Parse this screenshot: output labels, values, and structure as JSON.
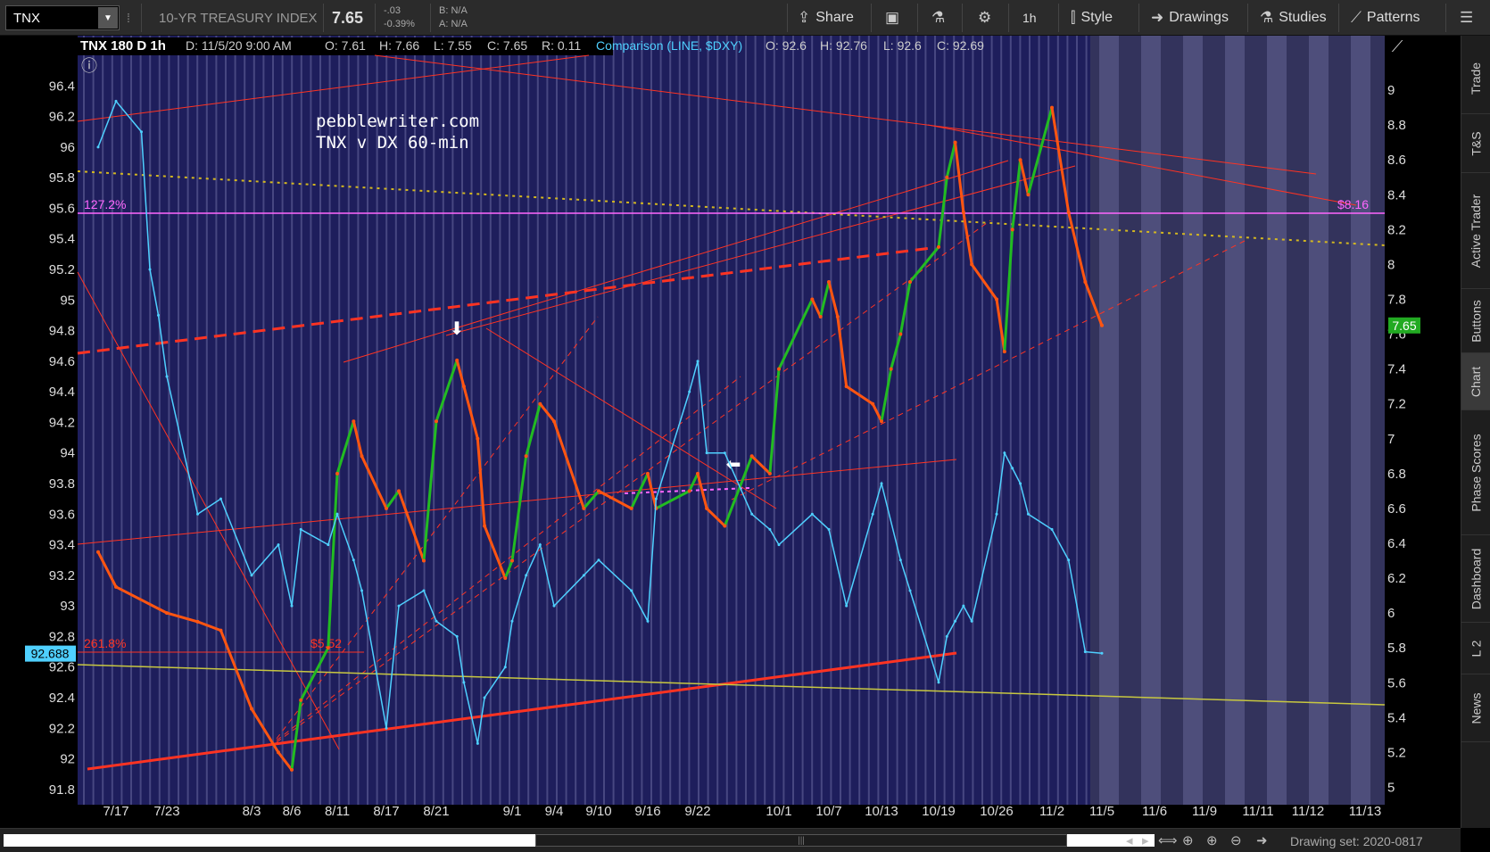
{
  "toolbar": {
    "symbol": "TNX",
    "description": "10-YR TREASURY INDEX",
    "last": "7.65",
    "change": "-.03",
    "change_pct": "-0.39%",
    "bid": "B: N/A",
    "ask": "A: N/A",
    "share_label": "Share",
    "timeframe": "1h",
    "style_label": "Style",
    "drawings_label": "Drawings",
    "studies_label": "Studies",
    "patterns_label": "Patterns"
  },
  "header": {
    "title": "TNX 180 D 1h",
    "date": "D: 11/5/20 9:00 AM",
    "open": "O: 7.61",
    "high": "H: 7.66",
    "low": "L: 7.55",
    "close": "C: 7.65",
    "range": "R: 0.11",
    "comparison": "Comparison (LINE, $DXY)",
    "cmp_open": "O: 92.6",
    "cmp_high": "H: 92.76",
    "cmp_low": "L: 92.6",
    "cmp_close": "C: 92.69"
  },
  "annotations": {
    "site": "pebblewriter.com",
    "subtitle": "TNX v DX 60-min",
    "fib_upper": "127.2%",
    "fib_upper_price": "$8.16",
    "fib_lower": "261.8%",
    "fib_lower_price": "$5.52"
  },
  "price_badges": {
    "tnx_last": "7.65",
    "dxy_last": "92.688"
  },
  "colors": {
    "background": "#1e1e5c",
    "stripe": "#6a6aa0",
    "future_bg": "#33335c",
    "tnx_up": "#22bb22",
    "tnx_down": "#ff5511",
    "dxy_line": "#4fd0ff",
    "trendline": "#ff3322",
    "fib_magenta": "#ff66ff",
    "yellow_dotted": "#d4b820",
    "yellow_line": "#c8c840"
  },
  "chart_data": {
    "type": "line",
    "x_labels": [
      "7/17",
      "7/23",
      "8/3",
      "8/6",
      "8/11",
      "8/17",
      "8/21",
      "9/1",
      "9/4",
      "9/10",
      "9/16",
      "9/22",
      "10/1",
      "10/7",
      "10/13",
      "10/19",
      "10/26",
      "11/2",
      "11/5",
      "11/6",
      "11/9",
      "11/11",
      "11/12",
      "11/13"
    ],
    "left_axis": {
      "label": "",
      "ticks": [
        "96.4",
        "96.2",
        "96",
        "95.8",
        "95.6",
        "95.4",
        "95.2",
        "95",
        "94.8",
        "94.6",
        "94.4",
        "94.2",
        "94",
        "93.8",
        "93.6",
        "93.4",
        "93.2",
        "93",
        "92.8",
        "92.6",
        "92.4",
        "92.2",
        "92",
        "91.8"
      ],
      "ylim": [
        91.7,
        96.6
      ]
    },
    "right_axis": {
      "label": "",
      "ticks": [
        "9",
        "8.8",
        "8.6",
        "8.4",
        "8.2",
        "8",
        "7.8",
        "7.6",
        "7.4",
        "7.2",
        "7",
        "6.8",
        "6.6",
        "6.4",
        "6.2",
        "6",
        "5.8",
        "5.6",
        "5.4",
        "5.2",
        "5"
      ],
      "ylim": [
        4.9,
        9.2
      ]
    },
    "series": [
      {
        "name": "TNX",
        "axis": "right",
        "x": [
          "7/15",
          "7/17",
          "7/23",
          "7/27",
          "7/30",
          "8/3",
          "8/5",
          "8/6",
          "8/7",
          "8/10",
          "8/11",
          "8/13",
          "8/14",
          "8/17",
          "8/18",
          "8/20",
          "8/21",
          "8/24",
          "8/25",
          "8/27",
          "8/28",
          "8/31",
          "9/1",
          "9/2",
          "9/3",
          "9/4",
          "9/8",
          "9/10",
          "9/14",
          "9/16",
          "9/17",
          "9/21",
          "9/22",
          "9/23",
          "9/25",
          "9/28",
          "9/30",
          "10/1",
          "10/5",
          "10/6",
          "10/7",
          "10/8",
          "10/9",
          "10/12",
          "10/13",
          "10/14",
          "10/15",
          "10/16",
          "10/19",
          "10/20",
          "10/21",
          "10/22",
          "10/23",
          "10/26",
          "10/27",
          "10/28",
          "10/29",
          "10/30",
          "11/2",
          "11/3",
          "11/4",
          "11/5"
        ],
        "values": [
          6.35,
          6.15,
          6.0,
          5.95,
          5.9,
          5.45,
          5.2,
          5.1,
          5.5,
          5.8,
          6.8,
          7.1,
          6.9,
          6.6,
          6.7,
          6.3,
          7.1,
          7.45,
          7.3,
          7.0,
          6.5,
          6.2,
          6.3,
          6.9,
          7.2,
          7.1,
          6.6,
          6.7,
          6.6,
          6.8,
          6.6,
          6.7,
          6.8,
          6.6,
          6.5,
          6.9,
          6.8,
          7.4,
          7.8,
          7.7,
          7.9,
          7.7,
          7.3,
          7.2,
          7.1,
          7.4,
          7.6,
          7.9,
          8.1,
          8.5,
          8.7,
          8.3,
          8.0,
          7.8,
          7.5,
          8.2,
          8.6,
          8.4,
          8.9,
          8.3,
          7.9,
          7.65
        ]
      },
      {
        "name": "$DXY",
        "axis": "left",
        "x": [
          "7/15",
          "7/17",
          "7/20",
          "7/21",
          "7/22",
          "7/23",
          "7/27",
          "7/30",
          "8/3",
          "8/5",
          "8/6",
          "8/7",
          "8/10",
          "8/11",
          "8/13",
          "8/14",
          "8/17",
          "8/18",
          "8/20",
          "8/21",
          "8/24",
          "8/25",
          "8/27",
          "8/28",
          "8/31",
          "9/1",
          "9/2",
          "9/3",
          "9/4",
          "9/8",
          "9/10",
          "9/14",
          "9/16",
          "9/17",
          "9/21",
          "9/22",
          "9/23",
          "9/25",
          "9/28",
          "9/30",
          "10/1",
          "10/5",
          "10/7",
          "10/9",
          "10/12",
          "10/13",
          "10/15",
          "10/16",
          "10/19",
          "10/20",
          "10/21",
          "10/22",
          "10/23",
          "10/26",
          "10/27",
          "10/28",
          "10/29",
          "10/30",
          "11/2",
          "11/3",
          "11/4",
          "11/5"
        ],
        "values": [
          96.0,
          96.3,
          96.1,
          95.2,
          94.9,
          94.5,
          93.6,
          93.7,
          93.2,
          93.4,
          93.0,
          93.5,
          93.4,
          93.6,
          93.3,
          93.1,
          92.2,
          93.0,
          93.1,
          92.9,
          92.8,
          92.5,
          92.1,
          92.4,
          92.6,
          92.9,
          93.2,
          93.4,
          93.0,
          93.2,
          93.3,
          93.1,
          92.9,
          93.7,
          94.4,
          94.6,
          94.0,
          94.0,
          93.6,
          93.5,
          93.4,
          93.6,
          93.5,
          93.0,
          93.6,
          93.8,
          93.3,
          93.1,
          92.5,
          92.8,
          92.9,
          93.0,
          92.9,
          93.6,
          94.0,
          93.9,
          93.8,
          93.6,
          93.5,
          93.3,
          92.7,
          92.69
        ]
      }
    ]
  },
  "bottom": {
    "drawing_set": "Drawing set: 2020-0817"
  },
  "sidebar": {
    "tabs": [
      "Trade",
      "T&S",
      "Active Trader",
      "Buttons",
      "Chart",
      "Phase Scores",
      "Dashboard",
      "L 2",
      "News"
    ]
  }
}
